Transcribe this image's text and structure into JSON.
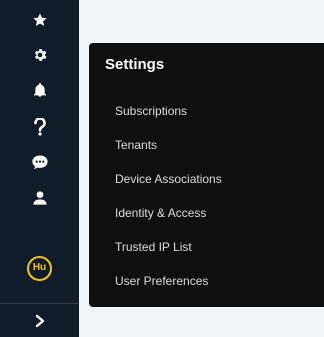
{
  "sidebar": {
    "icons": [
      "star-icon",
      "gear-icon",
      "bell-icon",
      "question-icon",
      "chat-icon",
      "user-icon"
    ],
    "avatar_initials": "Hu",
    "expand_icon": "chevron-right-icon"
  },
  "settings_panel": {
    "title": "Settings",
    "items": [
      {
        "label": "Subscriptions"
      },
      {
        "label": "Tenants"
      },
      {
        "label": "Device Associations"
      },
      {
        "label": "Identity & Access"
      },
      {
        "label": "Trusted IP List"
      },
      {
        "label": "User Preferences"
      }
    ]
  },
  "colors": {
    "sidebar_bg": "#111c2a",
    "panel_bg": "#0f0f0f",
    "page_bg": "#f2f4f6",
    "avatar_accent": "#f2c318"
  }
}
